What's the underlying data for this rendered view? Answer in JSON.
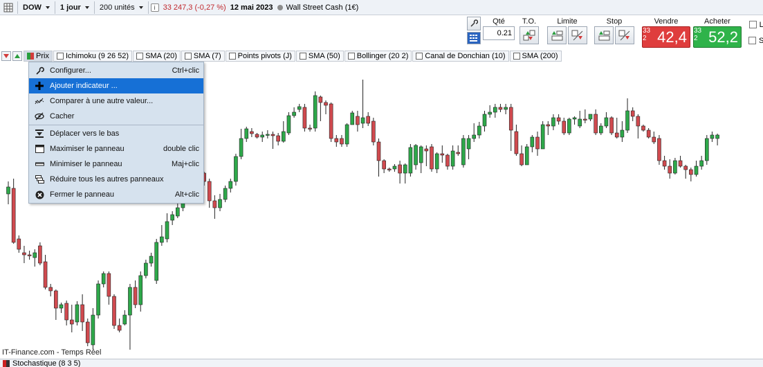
{
  "toolbar": {
    "symbol": "DOW",
    "timeframe": "1 jour",
    "units": "200 unités",
    "price": "33 247,3 (-0,27 %)",
    "date": "12 mai 2023",
    "instrument": "Wall Street Cash (1€)"
  },
  "order": {
    "qty_label": "Qté",
    "qty_value": "0.21",
    "to_label": "T.O.",
    "limit_label": "Limite",
    "stop_label": "Stop",
    "sell_label": "Vendre",
    "buy_label": "Acheter",
    "sell_small": "33 2",
    "sell_big": "42,4",
    "buy_small": "33 2",
    "buy_big": "52,2",
    "opt_l": "L",
    "opt_s": "S"
  },
  "tabs": [
    "Prix",
    "Ichimoku (9 26 52)",
    "SMA (20)",
    "SMA (7)",
    "Points pivots (J)",
    "SMA (50)",
    "Bollinger (20 2)",
    "Canal de Donchian (10)",
    "SMA (200)"
  ],
  "menu": [
    {
      "label": "Configurer...",
      "shortcut": "Ctrl+clic",
      "icon": "wrench-icon"
    },
    {
      "label": "Ajouter indicateur ...",
      "shortcut": "",
      "icon": "plus-icon",
      "highlighted": true
    },
    {
      "label": "Comparer à une autre valeur...",
      "shortcut": "",
      "icon": "compare-icon"
    },
    {
      "label": "Cacher",
      "shortcut": "",
      "icon": "eye-hidden-icon"
    },
    {
      "label": "Déplacer vers le bas",
      "shortcut": "",
      "icon": "move-down-icon"
    },
    {
      "label": "Maximiser le panneau",
      "shortcut": "double clic",
      "icon": "maximize-icon"
    },
    {
      "label": "Minimiser le panneau",
      "shortcut": "Maj+clic",
      "icon": "minimize-icon"
    },
    {
      "label": "Réduire tous les autres panneaux",
      "shortcut": "",
      "icon": "reduce-icon"
    },
    {
      "label": "Fermer le panneau",
      "shortcut": "Alt+clic",
      "icon": "close-icon"
    }
  ],
  "footer": "IT-Finance.com - Temps Réel",
  "bottom_panel": "Stochastique (8 3 5)",
  "colors": {
    "up": "#2ea84a",
    "down": "#d04a4f",
    "menu_highlight": "#1670d6",
    "sell": "#df3d3d",
    "buy": "#2fb34a"
  },
  "chart_data": {
    "type": "candlestick",
    "candles": [
      {
        "o": 280,
        "c": 270,
        "h": 262,
        "l": 295
      },
      {
        "o": 272,
        "c": 350,
        "h": 258,
        "l": 352
      },
      {
        "o": 345,
        "c": 360,
        "h": 340,
        "l": 365
      },
      {
        "o": 365,
        "c": 368,
        "h": 355,
        "l": 380
      },
      {
        "o": 368,
        "c": 368,
        "h": 362,
        "l": 375
      },
      {
        "o": 372,
        "c": 365,
        "h": 360,
        "l": 385
      },
      {
        "o": 355,
        "c": 380,
        "h": 350,
        "l": 383
      },
      {
        "o": 378,
        "c": 415,
        "h": 368,
        "l": 418
      },
      {
        "o": 415,
        "c": 420,
        "h": 410,
        "l": 428
      },
      {
        "o": 420,
        "c": 445,
        "h": 418,
        "l": 462
      },
      {
        "o": 445,
        "c": 440,
        "h": 437,
        "l": 452
      },
      {
        "o": 438,
        "c": 462,
        "h": 434,
        "l": 470
      },
      {
        "o": 462,
        "c": 468,
        "h": 440,
        "l": 480
      },
      {
        "o": 465,
        "c": 440,
        "h": 435,
        "l": 470
      },
      {
        "o": 440,
        "c": 465,
        "h": 425,
        "l": 478
      },
      {
        "o": 465,
        "c": 495,
        "h": 460,
        "l": 500
      },
      {
        "o": 498,
        "c": 455,
        "h": 445,
        "l": 505
      },
      {
        "o": 455,
        "c": 410,
        "h": 405,
        "l": 460
      },
      {
        "o": 410,
        "c": 395,
        "h": 392,
        "l": 415
      },
      {
        "o": 395,
        "c": 428,
        "h": 392,
        "l": 440
      },
      {
        "o": 428,
        "c": 470,
        "h": 425,
        "l": 475
      },
      {
        "o": 470,
        "c": 477,
        "h": 460,
        "l": 480
      },
      {
        "o": 468,
        "c": 455,
        "h": 448,
        "l": 470
      },
      {
        "o": 455,
        "c": 415,
        "h": 410,
        "l": 505
      },
      {
        "o": 415,
        "c": 440,
        "h": 405,
        "l": 445
      },
      {
        "o": 440,
        "c": 398,
        "h": 392,
        "l": 450
      },
      {
        "o": 398,
        "c": 380,
        "h": 375,
        "l": 402
      },
      {
        "o": 380,
        "c": 370,
        "h": 365,
        "l": 385
      },
      {
        "o": 405,
        "c": 350,
        "h": 345,
        "l": 410
      },
      {
        "o": 350,
        "c": 342,
        "h": 325,
        "l": 355
      },
      {
        "o": 345,
        "c": 320,
        "h": 308,
        "l": 350
      },
      {
        "o": 318,
        "c": 310,
        "h": 305,
        "l": 325
      },
      {
        "o": 312,
        "c": 300,
        "h": 290,
        "l": 315
      },
      {
        "o": 300,
        "c": 268,
        "h": 262,
        "l": 305
      },
      {
        "o": 268,
        "c": 240,
        "h": 240,
        "l": 272
      },
      {
        "o": 240,
        "c": 245,
        "h": 235,
        "l": 248
      },
      {
        "o": 245,
        "c": 250,
        "h": 240,
        "l": 260
      },
      {
        "o": 250,
        "c": 262,
        "h": 248,
        "l": 268
      },
      {
        "o": 262,
        "c": 290,
        "h": 258,
        "l": 300
      },
      {
        "o": 290,
        "c": 300,
        "h": 282,
        "l": 316
      },
      {
        "o": 300,
        "c": 288,
        "h": 280,
        "l": 305
      },
      {
        "o": 288,
        "c": 272,
        "h": 268,
        "l": 292
      },
      {
        "o": 272,
        "c": 262,
        "h": 258,
        "l": 278
      },
      {
        "o": 262,
        "c": 226,
        "h": 222,
        "l": 268
      },
      {
        "o": 226,
        "c": 200,
        "h": 186,
        "l": 230
      },
      {
        "o": 200,
        "c": 186,
        "h": 183,
        "l": 205
      },
      {
        "o": 190,
        "c": 193,
        "h": 185,
        "l": 198
      },
      {
        "o": 194,
        "c": 198,
        "h": 192,
        "l": 200
      },
      {
        "o": 198,
        "c": 195,
        "h": 190,
        "l": 205
      },
      {
        "o": 195,
        "c": 194,
        "h": 188,
        "l": 200
      },
      {
        "o": 194,
        "c": 196,
        "h": 190,
        "l": 215
      },
      {
        "o": 196,
        "c": 204,
        "h": 192,
        "l": 210
      },
      {
        "o": 204,
        "c": 190,
        "h": 175,
        "l": 206
      },
      {
        "o": 192,
        "c": 167,
        "h": 162,
        "l": 195
      },
      {
        "o": 167,
        "c": 162,
        "h": 155,
        "l": 170
      },
      {
        "o": 158,
        "c": 154,
        "h": 150,
        "l": 162
      },
      {
        "o": 155,
        "c": 185,
        "h": 150,
        "l": 190
      },
      {
        "o": 185,
        "c": 185,
        "h": 180,
        "l": 190
      },
      {
        "o": 185,
        "c": 138,
        "h": 132,
        "l": 190
      },
      {
        "o": 140,
        "c": 148,
        "h": 138,
        "l": 175
      },
      {
        "o": 148,
        "c": 152,
        "h": 145,
        "l": 165
      },
      {
        "o": 150,
        "c": 200,
        "h": 148,
        "l": 205
      },
      {
        "o": 200,
        "c": 205,
        "h": 195,
        "l": 212
      },
      {
        "o": 200,
        "c": 208,
        "h": 195,
        "l": 212
      },
      {
        "o": 208,
        "c": 180,
        "h": 178,
        "l": 212
      },
      {
        "o": 180,
        "c": 163,
        "h": 160,
        "l": 178
      },
      {
        "o": 168,
        "c": 180,
        "h": 160,
        "l": 190
      },
      {
        "o": 178,
        "c": 170,
        "h": 115,
        "l": 185
      },
      {
        "o": 168,
        "c": 178,
        "h": 162,
        "l": 182
      },
      {
        "o": 175,
        "c": 205,
        "h": 170,
        "l": 210
      },
      {
        "o": 205,
        "c": 232,
        "h": 200,
        "l": 255
      },
      {
        "o": 232,
        "c": 244,
        "h": 230,
        "l": 250
      },
      {
        "o": 244,
        "c": 244,
        "h": 242,
        "l": 248
      },
      {
        "o": 244,
        "c": 240,
        "h": 237,
        "l": 248
      },
      {
        "o": 238,
        "c": 250,
        "h": 232,
        "l": 265
      },
      {
        "o": 250,
        "c": 238,
        "h": 236,
        "l": 265
      },
      {
        "o": 250,
        "c": 213,
        "h": 208,
        "l": 255
      },
      {
        "o": 238,
        "c": 210,
        "h": 208,
        "l": 245
      },
      {
        "o": 235,
        "c": 212,
        "h": 210,
        "l": 250
      },
      {
        "o": 215,
        "c": 218,
        "h": 210,
        "l": 240
      },
      {
        "o": 212,
        "c": 244,
        "h": 208,
        "l": 248
      },
      {
        "o": 244,
        "c": 222,
        "h": 220,
        "l": 250
      },
      {
        "o": 222,
        "c": 224,
        "h": 210,
        "l": 235
      },
      {
        "o": 224,
        "c": 240,
        "h": 222,
        "l": 245
      },
      {
        "o": 240,
        "c": 218,
        "h": 210,
        "l": 245
      },
      {
        "o": 220,
        "c": 222,
        "h": 210,
        "l": 225
      },
      {
        "o": 238,
        "c": 200,
        "h": 195,
        "l": 242
      },
      {
        "o": 215,
        "c": 200,
        "h": 195,
        "l": 230
      },
      {
        "o": 200,
        "c": 195,
        "h": 178,
        "l": 205
      },
      {
        "o": 195,
        "c": 182,
        "h": 176,
        "l": 200
      },
      {
        "o": 182,
        "c": 165,
        "h": 160,
        "l": 190
      },
      {
        "o": 165,
        "c": 162,
        "h": 152,
        "l": 170
      },
      {
        "o": 162,
        "c": 155,
        "h": 150,
        "l": 170
      },
      {
        "o": 155,
        "c": 158,
        "h": 150,
        "l": 162
      },
      {
        "o": 158,
        "c": 155,
        "h": 150,
        "l": 165
      },
      {
        "o": 155,
        "c": 188,
        "h": 150,
        "l": 218
      },
      {
        "o": 190,
        "c": 222,
        "h": 180,
        "l": 225
      },
      {
        "o": 222,
        "c": 238,
        "h": 210,
        "l": 240
      },
      {
        "o": 238,
        "c": 212,
        "h": 208,
        "l": 235
      },
      {
        "o": 212,
        "c": 198,
        "h": 195,
        "l": 220
      },
      {
        "o": 198,
        "c": 215,
        "h": 190,
        "l": 225
      },
      {
        "o": 215,
        "c": 180,
        "h": 175,
        "l": 202
      },
      {
        "o": 180,
        "c": 182,
        "h": 175,
        "l": 195
      },
      {
        "o": 182,
        "c": 170,
        "h": 165,
        "l": 188
      },
      {
        "o": 170,
        "c": 175,
        "h": 165,
        "l": 180
      },
      {
        "o": 175,
        "c": 192,
        "h": 170,
        "l": 195
      },
      {
        "o": 192,
        "c": 172,
        "h": 170,
        "l": 195
      },
      {
        "o": 172,
        "c": 170,
        "h": 168,
        "l": 180
      },
      {
        "o": 182,
        "c": 172,
        "h": 160,
        "l": 185
      },
      {
        "o": 172,
        "c": 172,
        "h": 158,
        "l": 178
      },
      {
        "o": 172,
        "c": 165,
        "h": 165,
        "l": 175
      },
      {
        "o": 165,
        "c": 192,
        "h": 158,
        "l": 195
      },
      {
        "o": 192,
        "c": 182,
        "h": 178,
        "l": 195
      },
      {
        "o": 182,
        "c": 170,
        "h": 162,
        "l": 185
      },
      {
        "o": 170,
        "c": 192,
        "h": 168,
        "l": 195
      },
      {
        "o": 192,
        "c": 198,
        "h": 170,
        "l": 200
      },
      {
        "o": 198,
        "c": 188,
        "h": 175,
        "l": 205
      },
      {
        "o": 188,
        "c": 160,
        "h": 142,
        "l": 192
      },
      {
        "o": 160,
        "c": 168,
        "h": 155,
        "l": 175
      },
      {
        "o": 168,
        "c": 182,
        "h": 165,
        "l": 200
      },
      {
        "o": 182,
        "c": 188,
        "h": 180,
        "l": 190
      },
      {
        "o": 188,
        "c": 198,
        "h": 185,
        "l": 200
      },
      {
        "o": 198,
        "c": 205,
        "h": 190,
        "l": 208
      },
      {
        "o": 200,
        "c": 232,
        "h": 195,
        "l": 238
      },
      {
        "o": 232,
        "c": 240,
        "h": 225,
        "l": 245
      },
      {
        "o": 240,
        "c": 250,
        "h": 230,
        "l": 258
      },
      {
        "o": 250,
        "c": 232,
        "h": 228,
        "l": 252
      },
      {
        "o": 232,
        "c": 240,
        "h": 225,
        "l": 242
      },
      {
        "o": 240,
        "c": 245,
        "h": 238,
        "l": 258
      },
      {
        "o": 245,
        "c": 252,
        "h": 242,
        "l": 262
      },
      {
        "o": 252,
        "c": 240,
        "h": 232,
        "l": 255
      },
      {
        "o": 240,
        "c": 232,
        "h": 225,
        "l": 245
      },
      {
        "o": 232,
        "c": 200,
        "h": 195,
        "l": 238
      },
      {
        "o": 200,
        "c": 195,
        "h": 190,
        "l": 205
      },
      {
        "o": 200,
        "c": 195,
        "h": 193,
        "l": 210
      }
    ]
  }
}
